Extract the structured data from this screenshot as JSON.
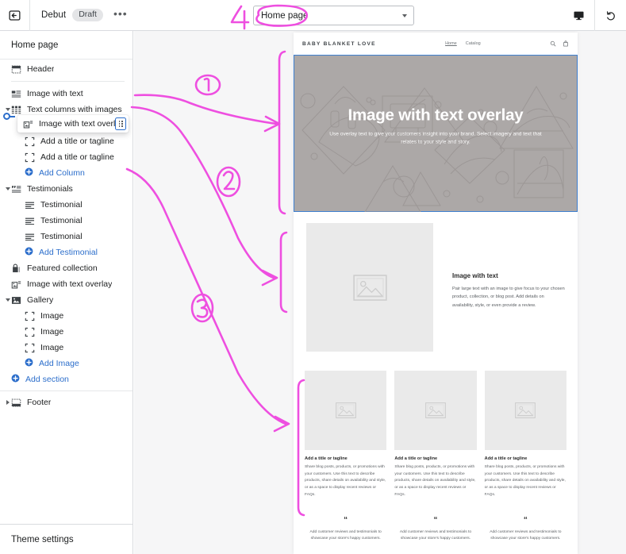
{
  "topbar": {
    "exit_icon": "exit-icon",
    "theme_name": "Debut",
    "status_badge": "Draft",
    "more_label": "•••",
    "page_selector": {
      "value": "Home page",
      "caret_icon": "chevron-down-icon"
    },
    "device_icon": "desktop-monitor-icon",
    "undo_icon": "undo-icon"
  },
  "sidebar": {
    "title": "Home page",
    "theme_settings_label": "Theme settings",
    "items": [
      {
        "label": "Header",
        "icon": "header-section-icon",
        "level": 0,
        "twisty": "none"
      },
      {
        "label": "Image with text",
        "icon": "image-with-text-icon",
        "level": 0,
        "twisty": "none"
      },
      {
        "label": "Text columns with images",
        "icon": "text-columns-icon",
        "level": 0,
        "twisty": "down"
      },
      {
        "label": "Add a title or tagline",
        "icon": "block-icon",
        "level": 1,
        "twisty": "none"
      },
      {
        "label": "Add a title or tagline",
        "icon": "block-icon",
        "level": 1,
        "twisty": "none"
      },
      {
        "label": "Add a title or tagline",
        "icon": "block-icon",
        "level": 1,
        "twisty": "none"
      },
      {
        "label": "Add Column",
        "icon": "plus-circle-icon",
        "level": 1,
        "twisty": "none",
        "add": true
      },
      {
        "label": "Testimonials",
        "icon": "testimonials-icon",
        "level": 0,
        "twisty": "down"
      },
      {
        "label": "Testimonial",
        "icon": "testimonial-block-icon",
        "level": 1,
        "twisty": "none"
      },
      {
        "label": "Testimonial",
        "icon": "testimonial-block-icon",
        "level": 1,
        "twisty": "none"
      },
      {
        "label": "Testimonial",
        "icon": "testimonial-block-icon",
        "level": 1,
        "twisty": "none"
      },
      {
        "label": "Add Testimonial",
        "icon": "plus-circle-icon",
        "level": 1,
        "twisty": "none",
        "add": true
      },
      {
        "label": "Featured collection",
        "icon": "featured-collection-icon",
        "level": 0,
        "twisty": "none"
      },
      {
        "label": "Image with text overlay",
        "icon": "image-with-text-overlay-icon",
        "level": 0,
        "twisty": "none"
      },
      {
        "label": "Gallery",
        "icon": "gallery-icon",
        "level": 0,
        "twisty": "down"
      },
      {
        "label": "Image",
        "icon": "block-icon",
        "level": 1,
        "twisty": "none"
      },
      {
        "label": "Image",
        "icon": "block-icon",
        "level": 1,
        "twisty": "none"
      },
      {
        "label": "Image",
        "icon": "block-icon",
        "level": 1,
        "twisty": "none"
      },
      {
        "label": "Add Image",
        "icon": "plus-circle-icon",
        "level": 1,
        "twisty": "none",
        "add": true
      },
      {
        "label": "Add section",
        "icon": "plus-circle-icon",
        "level": 0,
        "twisty": "none",
        "add": true
      }
    ],
    "footer_item": {
      "label": "Footer",
      "icon": "footer-section-icon",
      "twisty": "right"
    },
    "drag_card": {
      "label": "Image with text overlay",
      "icon": "image-with-text-overlay-icon",
      "handle_icon": "drag-handle-icon"
    }
  },
  "preview": {
    "store_header": {
      "logo": "BABY BLANKET LOVE",
      "nav": [
        "Home",
        "Catalog"
      ],
      "search_icon": "search-icon",
      "cart_icon": "shopping-bag-icon"
    },
    "hero": {
      "title": "Image with text overlay",
      "subtitle": "Use overlay text to give your customers insight into your brand. Select imagery and text that relates to your style and story.",
      "placeholder_icon": "collage-placeholder-icon",
      "selected": true,
      "selection_color": "#3e7fd0"
    },
    "image_with_text": {
      "placeholder_icon": "image-placeholder-icon",
      "heading": "Image with text",
      "body": "Pair large text with an image to give focus to your chosen product, collection, or blog post. Add details on availability, style, or even provide a review."
    },
    "columns": [
      {
        "placeholder_icon": "image-placeholder-icon",
        "heading": "Add a title or tagline",
        "body": "Share blog posts, products, or promotions with your customers. Use this text to describe products, share details on availability and style, or as a space to display recent reviews or FAQs."
      },
      {
        "placeholder_icon": "image-placeholder-icon",
        "heading": "Add a title or tagline",
        "body": "Share blog posts, products, or promotions with your customers. Use this text to describe products, share details on availability and style, or as a space to display recent reviews or FAQs."
      },
      {
        "placeholder_icon": "image-placeholder-icon",
        "heading": "Add a title or tagline",
        "body": "Share blog posts, products, or promotions with your customers. Use this text to describe products, share details on availability and style, or as a space to display recent reviews or FAQs."
      }
    ],
    "testimonials": [
      {
        "quote_mark": "“",
        "body": "Add customer reviews and testimonials to showcase your store's happy customers."
      },
      {
        "quote_mark": "“",
        "body": "Add customer reviews and testimonials to showcase your store's happy customers."
      },
      {
        "quote_mark": "“",
        "body": "Add customer reviews and testimonials to showcase your store's happy customers."
      }
    ]
  },
  "annotations": {
    "color": "#ee4fe0",
    "marks": [
      {
        "label": "1",
        "kind": "circled-number"
      },
      {
        "label": "2",
        "kind": "circled-number"
      },
      {
        "label": "3",
        "kind": "circled-number"
      },
      {
        "label": "4",
        "kind": "circled-number"
      }
    ]
  }
}
